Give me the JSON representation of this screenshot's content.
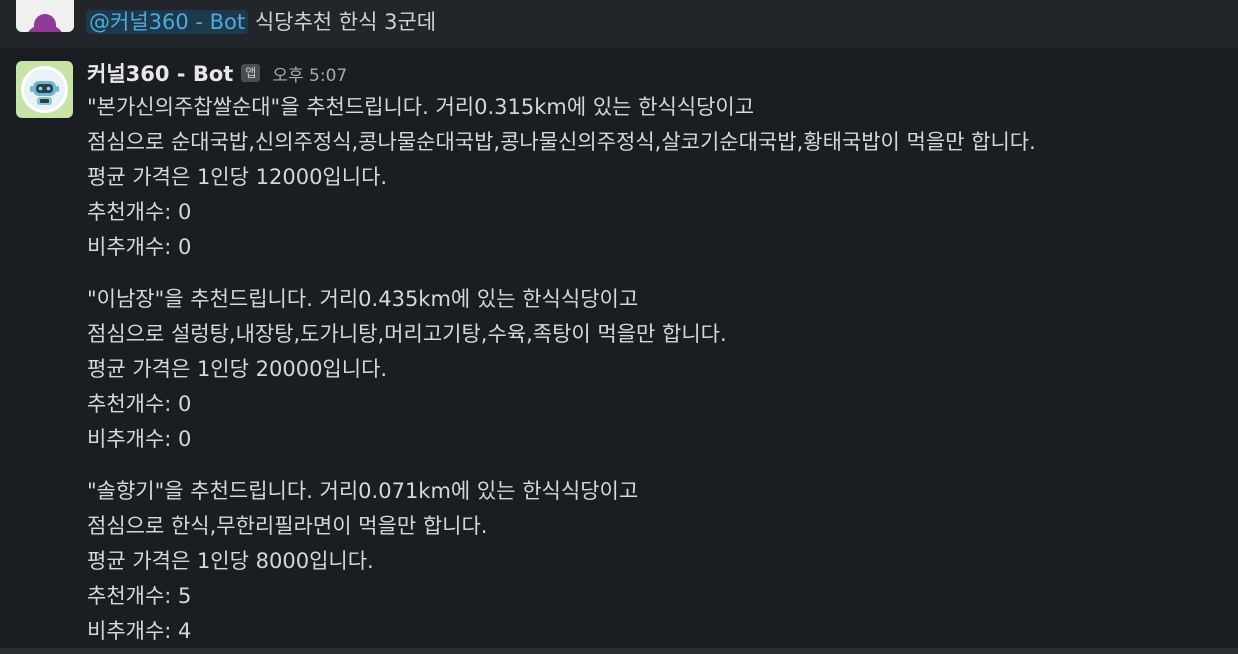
{
  "previous_message": {
    "mention": "@커널360 - Bot",
    "text": "식당추천 한식 3군데"
  },
  "message": {
    "sender": "커널360 - Bot",
    "app_badge": "앱",
    "timestamp": "오후 5:07",
    "recommendations": [
      {
        "line1": "\"본가신의주찹쌀순대\"을 추천드립니다. 거리0.315km에 있는 한식식당이고",
        "line2": "점심으로 순대국밥,신의주정식,콩나물순대국밥,콩나물신의주정식,살코기순대국밥,황태국밥이 먹을만 합니다.",
        "line3": "평균 가격은 1인당 12000입니다.",
        "line4": "추천개수: 0",
        "line5": "비추개수: 0"
      },
      {
        "line1": "\"이남장\"을 추천드립니다. 거리0.435km에 있는 한식식당이고",
        "line2": "점심으로 설렁탕,내장탕,도가니탕,머리고기탕,수육,족탕이 먹을만 합니다.",
        "line3": "평균 가격은 1인당 20000입니다.",
        "line4": "추천개수: 0",
        "line5": "비추개수: 0"
      },
      {
        "line1": "\"솔향기\"을 추천드립니다. 거리0.071km에 있는 한식식당이고",
        "line2": "점심으로 한식,무한리필라면이 먹을만 합니다.",
        "line3": "평균 가격은 1인당 8000입니다.",
        "line4": "추천개수: 5",
        "line5": "비추개수: 4"
      }
    ]
  }
}
